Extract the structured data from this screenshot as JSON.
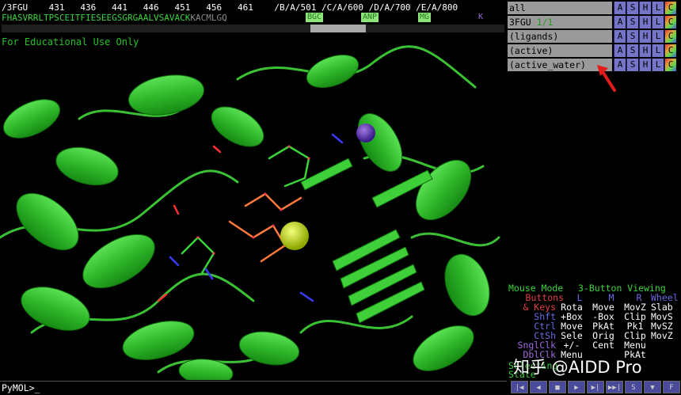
{
  "sequence_viewer": {
    "header_line": "/3FGU    431   436   441   446   451   456   461    /B/A/501 /C/A/600 /D/A/700 /E/A/800",
    "residues_green": "FHASVRRLTPSCEITFIESEEGSGRGAALVSAVACK",
    "residues_grey": "KACMLGQ",
    "ligands": [
      "BGC",
      "ANP",
      "MG",
      "K"
    ]
  },
  "viewer": {
    "watermark": "For Educational Use Only"
  },
  "objects": [
    {
      "name": "all",
      "frac": ""
    },
    {
      "name": "3FGU",
      "frac": "1/1"
    },
    {
      "name": "(ligands)",
      "frac": ""
    },
    {
      "name": "(active)",
      "frac": ""
    },
    {
      "name": "(active_water)",
      "frac": ""
    }
  ],
  "object_buttons": [
    "A",
    "S",
    "H",
    "L",
    "C"
  ],
  "mouse_mode": {
    "title_left": "Mouse Mode",
    "title_right": "3-Button Viewing",
    "header": [
      "Buttons",
      "L",
      "M",
      "R",
      "Wheel"
    ],
    "rows": [
      {
        "mod": "& Keys",
        "vals": [
          "Rota",
          "Move",
          "MovZ",
          "Slab"
        ]
      },
      {
        "mod": "Shft",
        "vals": [
          "+Box",
          "-Box",
          "Clip",
          "MovS"
        ]
      },
      {
        "mod": "Ctrl",
        "vals": [
          "Move",
          "PkAt",
          "Pk1",
          "MvSZ"
        ]
      },
      {
        "mod": "CtSh",
        "vals": [
          "Sele",
          "Orig",
          "Clip",
          "MovZ"
        ]
      },
      {
        "mod": "SnglClk",
        "vals": [
          "+/-",
          "Cent",
          "Menu",
          ""
        ]
      },
      {
        "mod": "DblClk",
        "vals": [
          "Menu",
          "",
          "PkAt",
          ""
        ]
      }
    ],
    "selecting_label": "Selecting",
    "state_label": "State"
  },
  "command_line": {
    "prompt": "PyMOL>_"
  },
  "playback_buttons": [
    "|◀",
    "◀",
    "■",
    "▶",
    "▶|",
    "▶▶|",
    "S",
    "▼",
    "F"
  ],
  "watermark_zh": "知乎 @AIDD Pro",
  "colors": {
    "cartoon": "#34c22e",
    "panel_button": "#7575c8",
    "object_name_bg": "#9a9a9a",
    "arrow": "#e21b1b"
  }
}
